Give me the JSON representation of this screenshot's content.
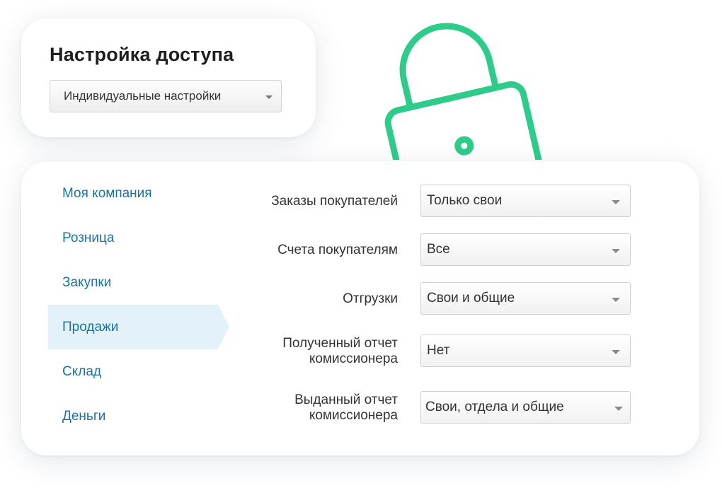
{
  "header": {
    "title": "Настройка доступа",
    "mode_select": {
      "value": "Индивидуальные настройки",
      "arrow_icon": "chevron-down-icon"
    }
  },
  "decoration": {
    "lock_icon": "lock-icon",
    "lock_color": "#2ecc8a"
  },
  "nav": {
    "items": [
      {
        "label": "Моя компания",
        "active": false
      },
      {
        "label": "Розница",
        "active": false
      },
      {
        "label": "Закупки",
        "active": false
      },
      {
        "label": "Продажи",
        "active": true
      },
      {
        "label": "Склад",
        "active": false
      },
      {
        "label": "Деньги",
        "active": false
      }
    ],
    "link_color": "#1c72a4",
    "active_background": "#e3f1fb"
  },
  "permissions": [
    {
      "label": "Заказы покупателей",
      "value": "Только свои"
    },
    {
      "label": "Счета покупателям",
      "value": "Все"
    },
    {
      "label": "Отгрузки",
      "value": "Свои и общие"
    },
    {
      "label_lines": [
        "Полученный отчет",
        "комиссионера"
      ],
      "value": "Нет"
    },
    {
      "label_lines": [
        "Выданный отчет",
        "комиссионера"
      ],
      "value": "Свои, отдела и общие"
    }
  ]
}
